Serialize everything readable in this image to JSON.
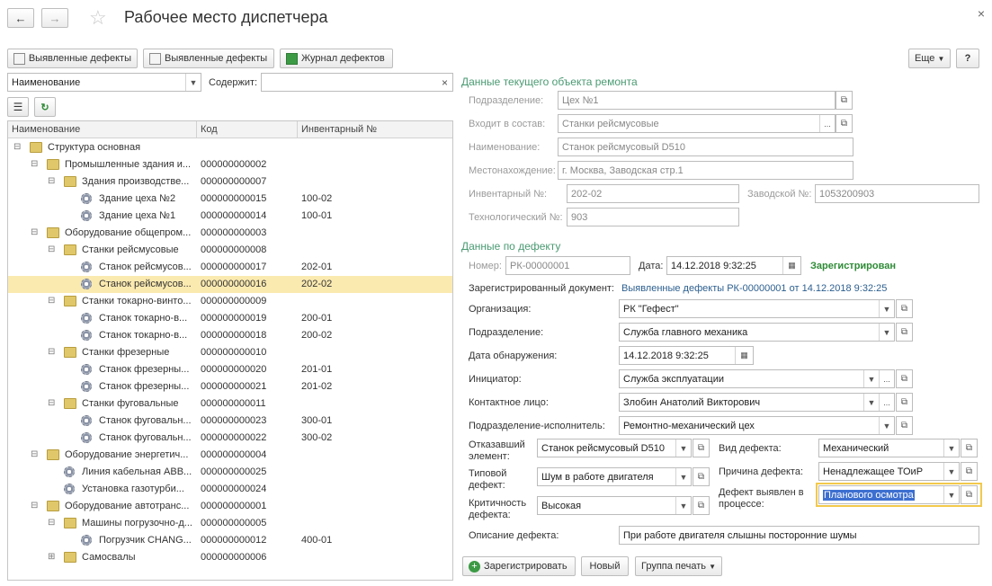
{
  "window": {
    "title": "Рабочее место диспетчера",
    "back_icon": "arrow-left-icon",
    "forward_icon": "arrow-right-icon",
    "favorite_icon": "star-icon",
    "close_icon": "close-icon"
  },
  "toolbar": {
    "btn1": "Выявленные дефекты",
    "btn2": "Выявленные дефекты",
    "btn3": "Журнал дефектов",
    "more": "Еще",
    "help": "?"
  },
  "filter": {
    "field_value": "Наименование",
    "contains_label": "Содержит:",
    "contains_value": "",
    "clear_icon": "×"
  },
  "tree": {
    "columns": [
      "Наименование",
      "Код",
      "Инвентарный №"
    ],
    "rows": [
      {
        "name": "Структура основная",
        "code": "",
        "inv": ""
      },
      {
        "name": "Промышленные здания и...",
        "code": "000000000002",
        "inv": ""
      },
      {
        "name": "Здания производстве...",
        "code": "000000000007",
        "inv": ""
      },
      {
        "name": "Здание цеха №2",
        "code": "000000000015",
        "inv": "100-02"
      },
      {
        "name": "Здание цеха №1",
        "code": "000000000014",
        "inv": "100-01"
      },
      {
        "name": "Оборудование общепром...",
        "code": "000000000003",
        "inv": ""
      },
      {
        "name": "Станки рейсмусовые",
        "code": "000000000008",
        "inv": ""
      },
      {
        "name": "Станок рейсмусов...",
        "code": "000000000017",
        "inv": "202-01"
      },
      {
        "name": "Станок рейсмусов...",
        "code": "000000000016",
        "inv": "202-02"
      },
      {
        "name": "Станки токарно-винто...",
        "code": "000000000009",
        "inv": ""
      },
      {
        "name": "Станок токарно-в...",
        "code": "000000000019",
        "inv": "200-01"
      },
      {
        "name": "Станок токарно-в...",
        "code": "000000000018",
        "inv": "200-02"
      },
      {
        "name": "Станки фрезерные",
        "code": "000000000010",
        "inv": ""
      },
      {
        "name": "Станок фрезерны...",
        "code": "000000000020",
        "inv": "201-01"
      },
      {
        "name": "Станок фрезерны...",
        "code": "000000000021",
        "inv": "201-02"
      },
      {
        "name": "Станки фуговальные",
        "code": "000000000011",
        "inv": ""
      },
      {
        "name": "Станок фуговальн...",
        "code": "000000000023",
        "inv": "300-01"
      },
      {
        "name": "Станок фуговальн...",
        "code": "000000000022",
        "inv": "300-02"
      },
      {
        "name": "Оборудование энергетич...",
        "code": "000000000004",
        "inv": ""
      },
      {
        "name": "Линия кабельная ABB...",
        "code": "000000000025",
        "inv": ""
      },
      {
        "name": "Установка газотурби...",
        "code": "000000000024",
        "inv": ""
      },
      {
        "name": "Оборудование автотранс...",
        "code": "000000000001",
        "inv": ""
      },
      {
        "name": "Машины погрузочно-д...",
        "code": "000000000005",
        "inv": ""
      },
      {
        "name": "Погрузчик CHANG...",
        "code": "000000000012",
        "inv": "400-01"
      },
      {
        "name": "Самосвалы",
        "code": "000000000006",
        "inv": ""
      }
    ]
  },
  "object": {
    "section_title": "Данные текущего объекта ремонта",
    "subdivision_label": "Подразделение:",
    "subdivision_value": "Цех №1",
    "part_of_label": "Входит в состав:",
    "part_of_value": "Станки рейсмусовые",
    "name_label": "Наименование:",
    "name_value": "Станок рейсмусовый D510",
    "location_label": "Местонахождение:",
    "location_value": "г. Москва, Заводская стр.1",
    "inv_label": "Инвентарный №:",
    "inv_value": "202-02",
    "factory_label": "Заводской №:",
    "factory_value": "1053200903",
    "tech_label": "Технологический №:",
    "tech_value": "903"
  },
  "defect": {
    "section_title": "Данные по дефекту",
    "number_label": "Номер:",
    "number_value": "РК-00000001",
    "date_label": "Дата:",
    "date_value": "14.12.2018  9:32:25",
    "status": "Зарегистрирован",
    "reg_doc_label": "Зарегистрированный документ:",
    "reg_doc_link": "Выявленные дефекты РК-00000001 от 14.12.2018 9:32:25",
    "org_label": "Организация:",
    "org_value": "РК \"Гефест\"",
    "subdiv_label": "Подразделение:",
    "subdiv_value": "Служба главного механика",
    "detect_date_label": "Дата обнаружения:",
    "detect_date_value": "14.12.2018  9:32:25",
    "initiator_label": "Инициатор:",
    "initiator_value": "Служба эксплуатации",
    "contact_label": "Контактное лицо:",
    "contact_value": "Злобин Анатолий Викторович",
    "executor_label": "Подразделение-исполнитель:",
    "executor_value": "Ремонтно-механический цех",
    "failed_label_1": "Отказавший",
    "failed_label_2": "элемент:",
    "failed_value": "Станок рейсмусовый D510",
    "typical_label_1": "Типовой",
    "typical_label_2": "дефект:",
    "typical_value": "Шум в работе двигателя",
    "critical_label_1": "Критичность",
    "critical_label_2": "дефекта:",
    "critical_value": "Высокая",
    "type_label": "Вид дефекта:",
    "type_value": "Механический",
    "cause_label": "Причина дефекта:",
    "cause_value": "Ненадлежащее ТОиР",
    "found_label_1": "Дефект выявлен в",
    "found_label_2": "процессе:",
    "found_value": "Планового осмотра",
    "desc_label": "Описание дефекта:",
    "desc_value": "При работе двигателя слышны посторонние шумы"
  },
  "actions": {
    "register": "Зарегистрировать",
    "new": "Новый",
    "print_group": "Группа печать"
  }
}
